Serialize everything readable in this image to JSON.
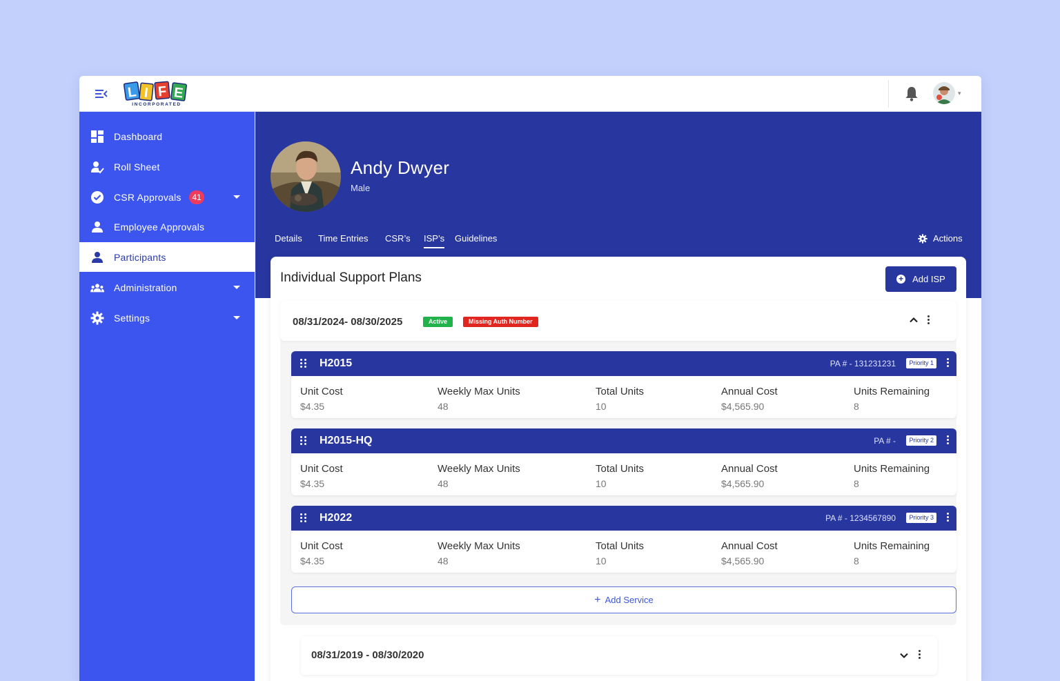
{
  "topbar": {
    "logo_text": "LIFE",
    "logo_subtext": "INCORPORATED"
  },
  "sidebar": {
    "items": [
      {
        "label": "Dashboard",
        "icon": "dashboard-icon"
      },
      {
        "label": "Roll Sheet",
        "icon": "roll-sheet-icon"
      },
      {
        "label": "CSR Approvals",
        "icon": "check-circle-icon",
        "badge": "41"
      },
      {
        "label": "Employee Approvals",
        "icon": "person-icon"
      },
      {
        "label": "Participants",
        "icon": "person-icon"
      },
      {
        "label": "Administration",
        "icon": "group-icon"
      },
      {
        "label": "Settings",
        "icon": "gear-icon"
      }
    ]
  },
  "profile": {
    "name": "Andy Dwyer",
    "gender": "Male"
  },
  "tabs": [
    "Details",
    "Time Entries",
    "CSR’s",
    "ISP’s",
    "Guidelines"
  ],
  "actions_label": "Actions",
  "card": {
    "title": "Individual Support Plans",
    "add_button": "Add ISP"
  },
  "plan": {
    "dates": "08/31/2024- 08/30/2025",
    "status": "Active",
    "warning": "Missing Auth Number",
    "services": [
      {
        "code": "H2015",
        "pa": "PA # - 131231231",
        "priority": "Priority 1",
        "fields": [
          {
            "label": "Unit Cost",
            "value": "$4.35"
          },
          {
            "label": "Weekly Max Units",
            "value": "48"
          },
          {
            "label": "Total Units",
            "value": "10"
          },
          {
            "label": "Annual Cost",
            "value": "$4,565.90"
          },
          {
            "label": "Units Remaining",
            "value": "8"
          }
        ]
      },
      {
        "code": "H2015-HQ",
        "pa": "PA # -",
        "priority": "Priority 2",
        "fields": [
          {
            "label": "Unit Cost",
            "value": "$4.35"
          },
          {
            "label": "Weekly Max Units",
            "value": "48"
          },
          {
            "label": "Total Units",
            "value": "10"
          },
          {
            "label": "Annual Cost",
            "value": "$4,565.90"
          },
          {
            "label": "Units Remaining",
            "value": "8"
          }
        ]
      },
      {
        "code": "H2022",
        "pa": "PA # - 1234567890",
        "priority": "Priority 3",
        "fields": [
          {
            "label": "Unit Cost",
            "value": "$4.35"
          },
          {
            "label": "Weekly Max Units",
            "value": "48"
          },
          {
            "label": "Total Units",
            "value": "10"
          },
          {
            "label": "Annual Cost",
            "value": "$4,565.90"
          },
          {
            "label": "Units Remaining",
            "value": "8"
          }
        ]
      }
    ],
    "add_service_label": "Add Service"
  },
  "plan2": {
    "dates": "08/31/2019 - 08/30/2020"
  },
  "colors": {
    "background": "#c3d0fc",
    "sidebar": "#3b55ee",
    "header_navy": "#2836a0",
    "active_green": "#21b24b",
    "warning_red": "#e0261e",
    "badge_red": "#ef3b5b"
  }
}
